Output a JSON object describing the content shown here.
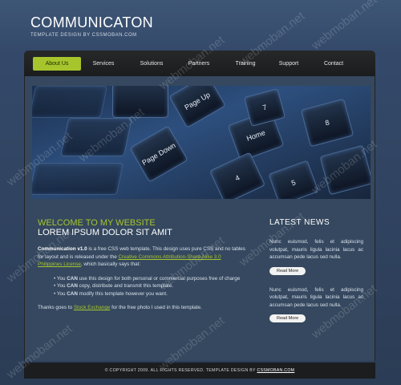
{
  "site": {
    "title": "COMMUNICATON",
    "tagline": "TEMPLATE DESIGN BY CSSMOBAN.COM"
  },
  "nav": {
    "items": [
      {
        "label": "About Us",
        "active": true
      },
      {
        "label": "Services"
      },
      {
        "label": "Solutions"
      },
      {
        "label": "Partners"
      },
      {
        "label": "Training"
      },
      {
        "label": "Support"
      },
      {
        "label": "Contact"
      }
    ]
  },
  "hero": {
    "keys": [
      "Page Up",
      "Page Down",
      "Home",
      "4",
      "5",
      "7",
      "8"
    ]
  },
  "main": {
    "welcome": "WELCOME TO MY WEBSITE",
    "subheading": "LOREM IPSUM DOLOR SIT AMIT",
    "intro_bold": "Communication v1.0",
    "intro_text1": " is a free CSS web template. This design uses pure CSS and no tables for layout and is released under the ",
    "intro_link": "Creative Commons Attribution-Share Alike 3.0 Philippines License",
    "intro_text2": ", which basically says that:",
    "bullets": [
      {
        "pre": "You ",
        "bold": "CAN",
        "post": " use this design for both personal or commercial purposes free of charge"
      },
      {
        "pre": "You ",
        "bold": "CAN",
        "post": " copy, distribute and transmit this template."
      },
      {
        "pre": "You ",
        "bold": "CAN",
        "post": " modify this template however you want."
      }
    ],
    "thanks_pre": "Thanks goes to ",
    "thanks_link": "Stock Exchange",
    "thanks_post": " for the free photo I used in this template."
  },
  "sidebar": {
    "title": "LATEST NEWS",
    "news": [
      {
        "text": "Nunc euismod, felis et adipiscing volutpat, mauris ligula lacinia lacus ac accumsan pede lacus sed nulla.",
        "button": "Read More"
      },
      {
        "text": "Nunc euismod, felis et adipiscing volutpat, mauris ligula lacinia lacus ac accumsan pede lacus sed nulla.",
        "button": "Read More"
      }
    ]
  },
  "footer": {
    "text": "© COPYRIGHT 2009. ALL RIGHTS RESERVED. TEMPLATE DESIGN BY ",
    "link": "CSSMOBAN.COM"
  },
  "watermark": "webmoban.net",
  "colors": {
    "accent": "#a6c52c",
    "background": "#35485f",
    "nav_bg": "#1f2122"
  }
}
